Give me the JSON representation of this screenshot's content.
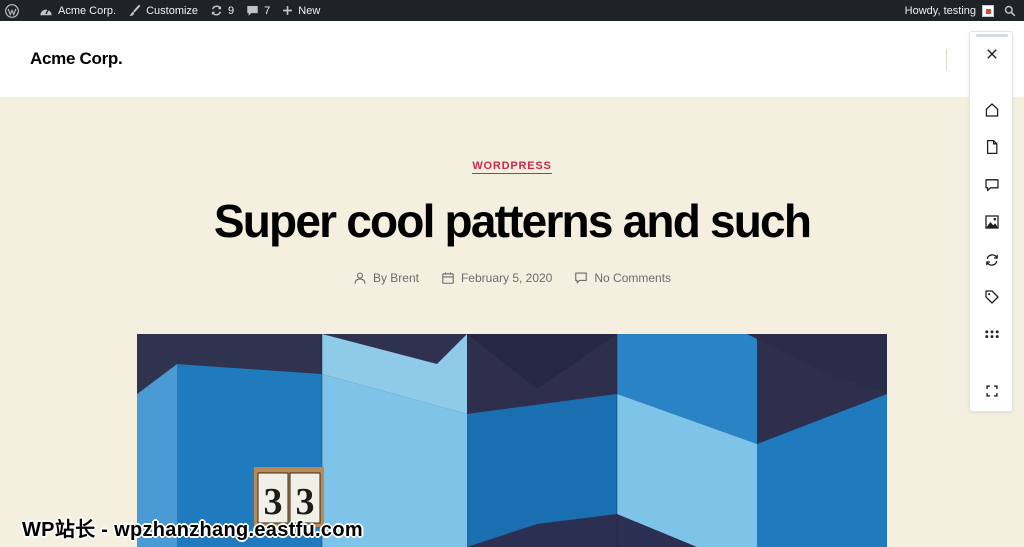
{
  "admin_bar": {
    "site_name": "Acme Corp.",
    "customize": "Customize",
    "updates_count": "9",
    "comments_count": "7",
    "new_label": "New",
    "greeting": "Howdy, testing"
  },
  "site": {
    "title": "Acme Corp."
  },
  "post": {
    "category": "WORDPRESS",
    "title": "Super cool patterns and such",
    "author": "By Brent",
    "date": "February 5, 2020",
    "comments": "No Comments"
  },
  "featured_image": {
    "number_text": "33"
  },
  "toolbar": {
    "icons": [
      "close-icon",
      "home-icon",
      "page-icon",
      "comment-icon",
      "image-icon",
      "refresh-icon",
      "tag-icon",
      "more-icon",
      "fullscreen-icon"
    ]
  },
  "watermark": "WP站长 - wpzhanzhang.eastfu.com",
  "colors": {
    "admin_bar_bg": "#1d2327",
    "page_bg": "#f5efe0",
    "accent": "#cd2653",
    "tile_dark": "#2d2f4d",
    "tile_mid": "#1f7bbd",
    "tile_light": "#7ec3e8"
  }
}
